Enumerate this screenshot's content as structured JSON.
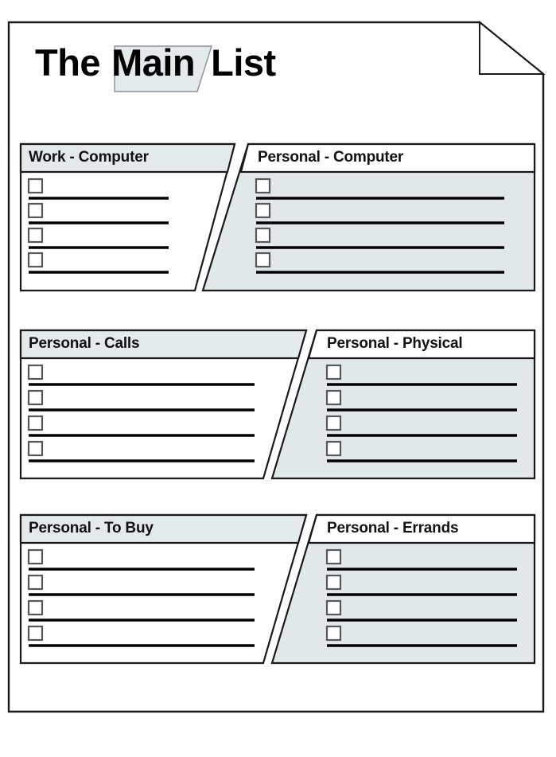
{
  "document": {
    "type": "printable-checklist-sheet",
    "title_parts": {
      "prefix": "The",
      "highlight": "Main",
      "suffix": "List"
    },
    "title_full": "The Main List",
    "corner_fold": "dog-eared-page-corner"
  },
  "colors": {
    "ink": "#000000",
    "panel_gray": "#e2e8ea",
    "header_gray": "#e4e9ec",
    "paper_white": "#ffffff",
    "border": "#1a1a1a",
    "checkbox_border": "#55595b"
  },
  "layout": {
    "rows": 3,
    "columns_per_row": 2,
    "rows_labels": [
      "row-1",
      "row-2",
      "row-3"
    ]
  },
  "sections": [
    {
      "id": "work-computer",
      "title": "Work - Computer",
      "row": 1,
      "side": "left",
      "style": "gray-header-white-body",
      "slant": "right-edge-slants-left-going-down",
      "items": [
        "",
        "",
        "",
        ""
      ],
      "item_count": 4
    },
    {
      "id": "personal-computer",
      "title": "Personal - Computer",
      "row": 1,
      "side": "right",
      "style": "white-header-gray-body",
      "slant": "left-edge-slants-left-going-down",
      "items": [
        "",
        "",
        "",
        ""
      ],
      "item_count": 4
    },
    {
      "id": "personal-calls",
      "title": "Personal - Calls",
      "row": 2,
      "side": "left",
      "style": "gray-header-white-body",
      "slant": "right-edge-slants-left-going-down",
      "items": [
        "",
        "",
        "",
        ""
      ],
      "item_count": 4
    },
    {
      "id": "personal-physical",
      "title": "Personal - Physical",
      "row": 2,
      "side": "right",
      "style": "white-header-gray-body",
      "slant": "left-edge-slants-left-going-down",
      "items": [
        "",
        "",
        "",
        ""
      ],
      "item_count": 4
    },
    {
      "id": "personal-to-buy",
      "title": "Personal - To Buy",
      "row": 3,
      "side": "left",
      "style": "gray-header-white-body",
      "slant": "right-edge-slants-left-going-down",
      "items": [
        "",
        "",
        "",
        ""
      ],
      "item_count": 4
    },
    {
      "id": "personal-errands",
      "title": "Personal - Errands",
      "row": 3,
      "side": "right",
      "style": "white-header-gray-body",
      "slant": "left-edge-slants-left-going-down",
      "items": [
        "",
        "",
        "",
        ""
      ],
      "item_count": 4
    }
  ]
}
